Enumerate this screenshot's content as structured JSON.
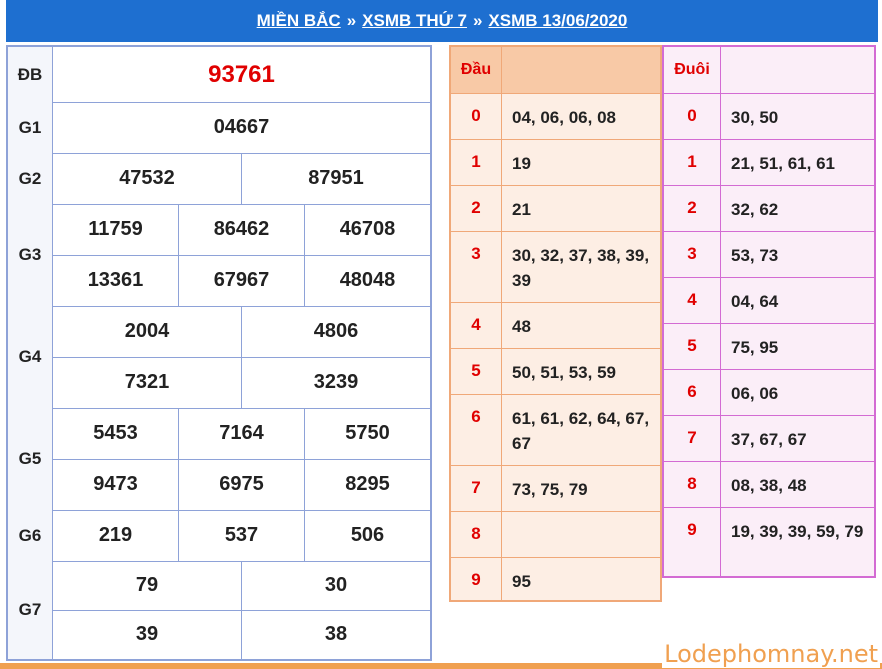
{
  "header": {
    "crumb1": "MIỀN BẮC",
    "crumb2": "XSMB THỨ 7",
    "crumb3": "XSMB 13/06/2020",
    "separator": "»"
  },
  "results": {
    "special": {
      "label": "ĐB",
      "values": [
        "93761"
      ]
    },
    "g1": {
      "label": "G1",
      "values": [
        "04667"
      ]
    },
    "g2": {
      "label": "G2",
      "values": [
        "47532",
        "87951"
      ]
    },
    "g3": {
      "label": "G3",
      "values": [
        "11759",
        "86462",
        "46708",
        "13361",
        "67967",
        "48048"
      ]
    },
    "g4": {
      "label": "G4",
      "values": [
        "2004",
        "4806",
        "7321",
        "3239"
      ]
    },
    "g5": {
      "label": "G5",
      "values": [
        "5453",
        "7164",
        "5750",
        "9473",
        "6975",
        "8295"
      ]
    },
    "g6": {
      "label": "G6",
      "values": [
        "219",
        "537",
        "506"
      ]
    },
    "g7": {
      "label": "G7",
      "values": [
        "79",
        "30",
        "39",
        "38"
      ]
    }
  },
  "dau": {
    "header": "Đầu",
    "rows": [
      {
        "key": "0",
        "value": "04, 06, 06, 08"
      },
      {
        "key": "1",
        "value": "19"
      },
      {
        "key": "2",
        "value": "21"
      },
      {
        "key": "3",
        "value": "30, 32, 37, 38, 39, 39"
      },
      {
        "key": "4",
        "value": "48"
      },
      {
        "key": "5",
        "value": "50, 51, 53, 59"
      },
      {
        "key": "6",
        "value": "61, 61, 62, 64, 67, 67"
      },
      {
        "key": "7",
        "value": "73, 75, 79"
      },
      {
        "key": "8",
        "value": ""
      },
      {
        "key": "9",
        "value": "95"
      }
    ]
  },
  "duoi": {
    "header": "Đuôi",
    "rows": [
      {
        "key": "0",
        "value": "30, 50"
      },
      {
        "key": "1",
        "value": "21, 51, 61, 61"
      },
      {
        "key": "2",
        "value": "32, 62"
      },
      {
        "key": "3",
        "value": "53, 73"
      },
      {
        "key": "4",
        "value": "04, 64"
      },
      {
        "key": "5",
        "value": "75, 95"
      },
      {
        "key": "6",
        "value": "06, 06"
      },
      {
        "key": "7",
        "value": "37, 67, 67"
      },
      {
        "key": "8",
        "value": "08, 38, 48"
      },
      {
        "key": "9",
        "value": "19, 39, 39, 59, 79"
      }
    ]
  },
  "watermark": "Lodephomnay.net",
  "colors": {
    "header_bg": "#1e6fd0",
    "special_red": "#e00000",
    "dau_border": "#f0a878",
    "duoi_border": "#d36bd3"
  }
}
